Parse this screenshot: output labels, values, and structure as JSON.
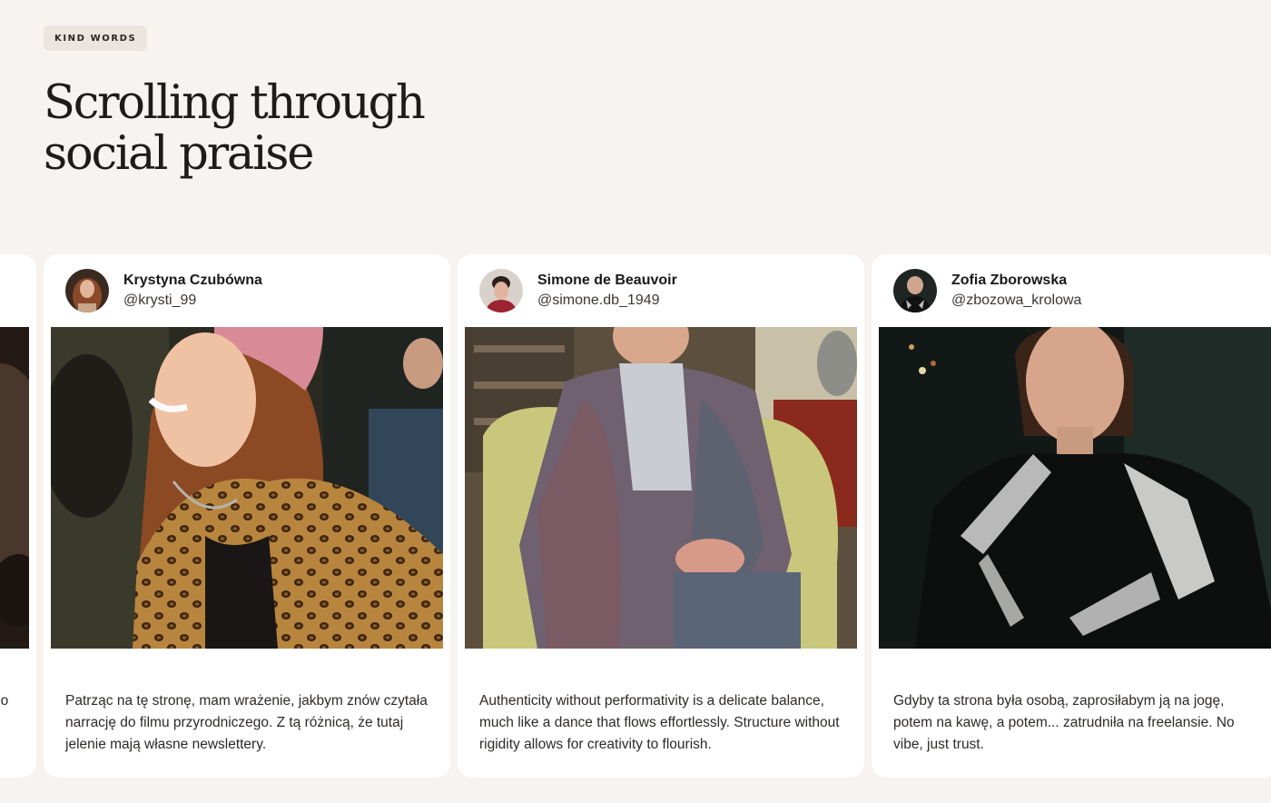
{
  "section": {
    "badge": "KIND WORDS",
    "title_line1": "Scrolling through",
    "title_line2": "social praise"
  },
  "testimonials": [
    {
      "name": "",
      "handle": "",
      "quote": "do"
    },
    {
      "name": "Krystyna Czubówna",
      "handle": "@krysti_99",
      "quote": "Patrząc na tę stronę, mam wrażenie, jakbym znów czytała narrację do filmu przyrodniczego. Z tą różnicą, że tutaj jelenie mają własne newslettery."
    },
    {
      "name": "Simone de Beauvoir",
      "handle": "@simone.db_1949",
      "quote": "Authenticity without performativity is a delicate balance, much like a dance that flows effortlessly. Structure without rigidity allows for creativity to flourish."
    },
    {
      "name": "Zofia Zborowska",
      "handle": "@zbozowa_krolowa",
      "quote": "Gdyby ta strona była osobą, zaprosiłabym ją na jogę, potem na kawę, a potem... zatrudniła na freelansie. No vibe, just trust."
    }
  ]
}
